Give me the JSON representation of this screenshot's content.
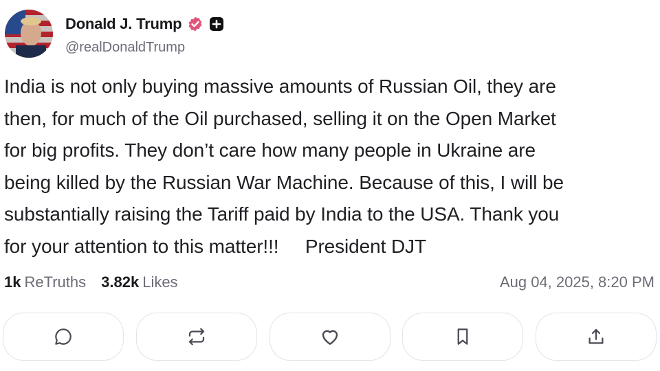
{
  "author": {
    "display_name": "Donald J. Trump",
    "handle": "@realDonaldTrump",
    "avatar": "avatar-photo",
    "verified_icon": "verified-badge-icon",
    "plus_icon": "plus-badge-icon",
    "verified_color": "#e0567b"
  },
  "post": {
    "text": "India is not only buying massive amounts of Russian Oil, they are\nthen, for much of the Oil purchased, selling it on the Open Market\nfor big profits. They don’t care how many people in Ukraine are\nbeing killed by the Russian War Machine. Because of this, I will be\nsubstantially raising the Tariff paid by India to the USA. Thank you\nfor your attention to this matter!!!     President DJT",
    "retruths_count": "1k",
    "retruths_label": "ReTruths",
    "likes_count": "3.82k",
    "likes_label": "Likes",
    "timestamp": "Aug 04, 2025, 8:20 PM"
  },
  "actions": [
    {
      "name": "reply",
      "icon": "comment-icon"
    },
    {
      "name": "retruth",
      "icon": "repost-icon"
    },
    {
      "name": "like",
      "icon": "heart-icon"
    },
    {
      "name": "bookmark",
      "icon": "bookmark-icon"
    },
    {
      "name": "share",
      "icon": "share-icon"
    }
  ]
}
